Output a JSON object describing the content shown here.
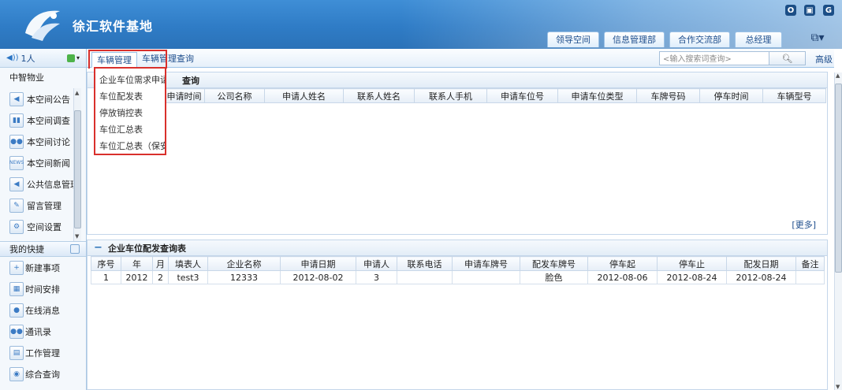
{
  "app": {
    "brand": "徐汇软件基地",
    "win_controls": [
      "O",
      "▣",
      "G"
    ]
  },
  "top_tabs": [
    "领导空间",
    "信息管理部",
    "合作交流部",
    "总经理"
  ],
  "sidebar": {
    "user": "1人",
    "section_title": "中智物业",
    "items": [
      {
        "label": "本空间公告",
        "icon": "announcement-icon"
      },
      {
        "label": "本空间调查",
        "icon": "survey-icon"
      },
      {
        "label": "本空间讨论",
        "icon": "discussion-icon"
      },
      {
        "label": "本空间新闻",
        "icon": "news-icon"
      },
      {
        "label": "公共信息管理",
        "icon": "public-info-icon"
      },
      {
        "label": "留言管理",
        "icon": "message-icon"
      },
      {
        "label": "空间设置",
        "icon": "settings-icon"
      }
    ],
    "quick_title": "我的快捷",
    "quick_items": [
      {
        "label": "新建事项",
        "icon": "new-item-icon"
      },
      {
        "label": "时间安排",
        "icon": "calendar-icon"
      },
      {
        "label": "在线消息",
        "icon": "online-message-icon"
      },
      {
        "label": "通讯录",
        "icon": "contacts-icon"
      },
      {
        "label": "工作管理",
        "icon": "work-icon"
      },
      {
        "label": "综合查询",
        "icon": "query-icon"
      }
    ]
  },
  "main": {
    "tabs": [
      "车辆管理",
      "车辆管理查询"
    ],
    "search_placeholder": "<输入搜索词查询>",
    "advanced": "高级",
    "dropdown": [
      "企业车位需求申请.",
      "车位配发表",
      "停放销控表",
      "车位汇总表",
      "车位汇总表（保安."
    ],
    "upper_panel": {
      "title": "查询",
      "columns": [
        "申请时间",
        "公司名称",
        "申请人姓名",
        "联系人姓名",
        "联系人手机",
        "申请车位号",
        "申请车位类型",
        "车牌号码",
        "停车时间",
        "车辆型号"
      ],
      "more": "[更多]"
    },
    "lower_panel": {
      "title": "企业车位配发查询表",
      "columns": [
        "序号",
        "年",
        "月",
        "填表人",
        "企业名称",
        "申请日期",
        "申请人",
        "联系电话",
        "申请车牌号",
        "配发车牌号",
        "停车起",
        "停车止",
        "配发日期",
        "备注"
      ],
      "rows": [
        [
          "1",
          "2012",
          "2",
          "test3",
          "12333",
          "2012-08-02",
          "3",
          "",
          "",
          "脸色",
          "2012-08-06",
          "2012-08-24",
          "2012-08-24",
          ""
        ]
      ]
    }
  }
}
